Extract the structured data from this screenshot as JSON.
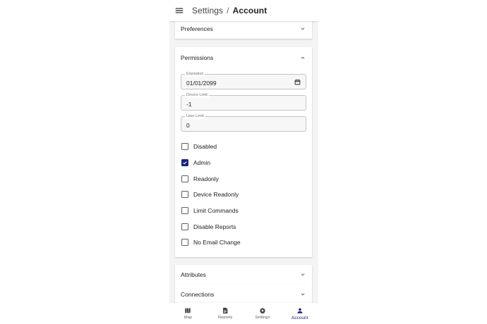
{
  "header": {
    "breadcrumb_parent": "Settings",
    "breadcrumb_separator": "/",
    "breadcrumb_current": "Account"
  },
  "panels": {
    "preferences": "Preferences",
    "permissions": "Permissions",
    "attributes": "Attributes",
    "connections": "Connections"
  },
  "fields": {
    "expiration": {
      "label": "Expiration",
      "value": "01/01/2099"
    },
    "device_limit": {
      "label": "Device Limit",
      "value": "-1"
    },
    "user_limit": {
      "label": "User Limit",
      "value": "0"
    }
  },
  "checkboxes": [
    {
      "label": "Disabled",
      "checked": false
    },
    {
      "label": "Admin",
      "checked": true
    },
    {
      "label": "Readonly",
      "checked": false
    },
    {
      "label": "Device Readonly",
      "checked": false
    },
    {
      "label": "Limit Commands",
      "checked": false
    },
    {
      "label": "Disable Reports",
      "checked": false
    },
    {
      "label": "No Email Change",
      "checked": false
    }
  ],
  "nav": {
    "map": "Map",
    "reports": "Reports",
    "settings": "Settings",
    "account": "Account",
    "active": "account"
  },
  "colors": {
    "accent": "#1a237e",
    "background": "#f4f4f4",
    "surface": "#ffffff"
  }
}
